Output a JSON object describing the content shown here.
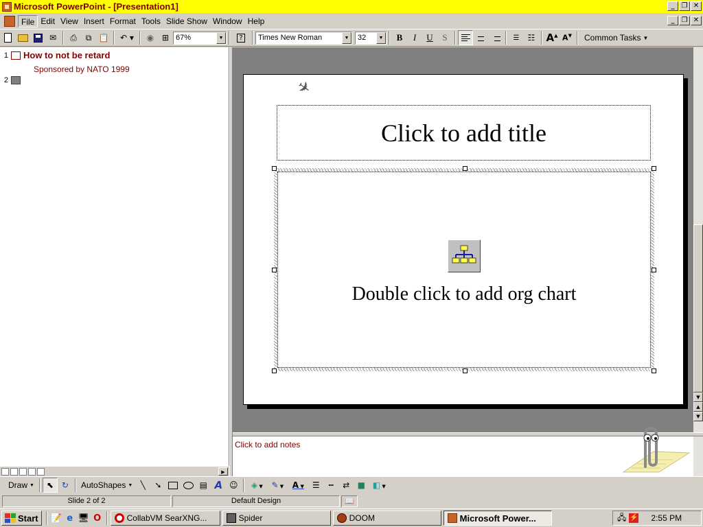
{
  "window": {
    "title": "Microsoft PowerPoint - [Presentation1]"
  },
  "menu": {
    "items": [
      "File",
      "Edit",
      "View",
      "Insert",
      "Format",
      "Tools",
      "Slide Show",
      "Window",
      "Help"
    ]
  },
  "toolbar": {
    "zoom": "67%",
    "font_name": "Times New Roman",
    "font_size": "32",
    "bold": "B",
    "italic": "I",
    "underline": "U",
    "shadow": "S",
    "common_tasks": "Common Tasks"
  },
  "outline": {
    "slides": [
      {
        "number": "1",
        "title": "How to not be retard",
        "subtitle": "Sponsored by NATO 1999"
      },
      {
        "number": "2",
        "title": ""
      }
    ]
  },
  "slide": {
    "title_placeholder": "Click to add title",
    "orgchart_placeholder": "Double click to add org chart"
  },
  "notes": {
    "placeholder": "Click to add notes"
  },
  "drawing_toolbar": {
    "draw_label": "Draw",
    "autoshapes_label": "AutoShapes"
  },
  "status": {
    "slide_position": "Slide 2 of 2",
    "design": "Default Design"
  },
  "taskbar": {
    "start_label": "Start",
    "tasks": [
      {
        "label": "CollabVM SearXNG...",
        "icon": "opera-icon",
        "color": "#cc0000"
      },
      {
        "label": "Spider",
        "icon": "spider-icon",
        "color": "#404040"
      },
      {
        "label": "DOOM",
        "icon": "doom-icon",
        "color": "#804000"
      },
      {
        "label": "Microsoft Power...",
        "icon": "powerpoint-icon",
        "color": "#c86428"
      }
    ],
    "clock": "2:55 PM"
  },
  "colors": {
    "title_bar": "#ffff00",
    "title_text": "#800000",
    "outline_text": "#800000",
    "workspace": "#808080",
    "chrome": "#d4d0c8"
  }
}
